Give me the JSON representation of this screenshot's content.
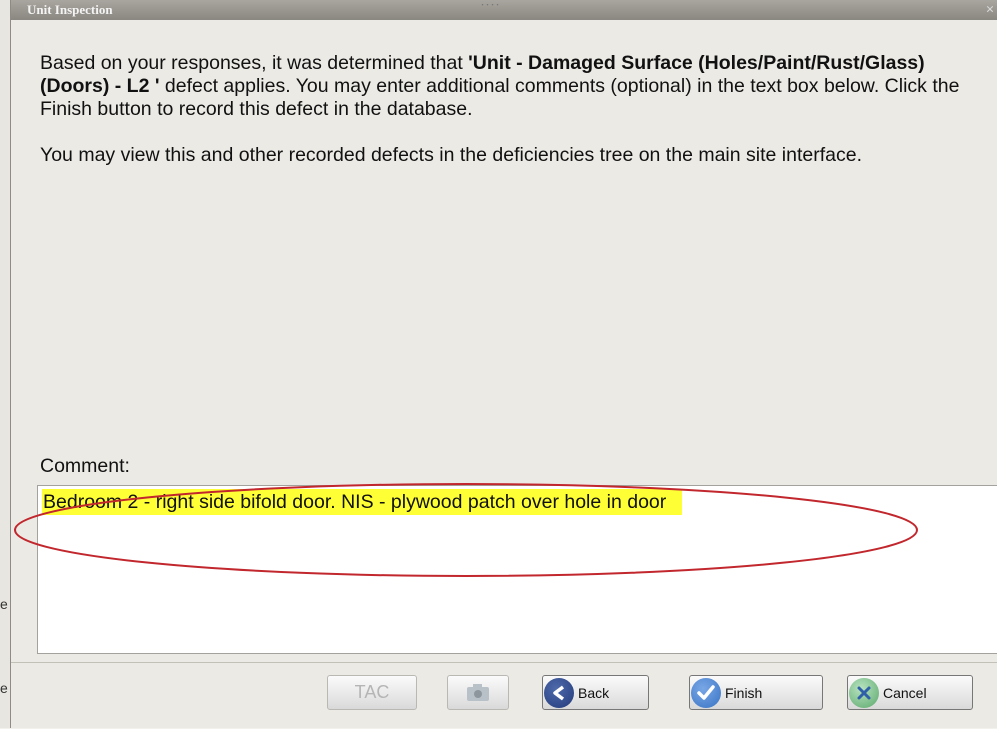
{
  "dialog": {
    "title": "Unit Inspection",
    "close": "×",
    "message": {
      "p1_before": "Based on your responses, it was determined that ",
      "p1_defect": "'Unit - Damaged Surface (Holes/Paint/Rust/Glass) (Doors) - L2 '",
      "p1_after": " defect applies. You may enter additional comments (optional) in the text box below. Click the Finish button to record this defect in the database.",
      "p2": "You may view this and other recorded defects in the deficiencies tree on the main site interface."
    },
    "comment_label": "Comment:",
    "comment_value": "Bedroom 2 - right side bifold door. NIS - plywood patch over hole in door"
  },
  "buttons": {
    "tac": "TAC",
    "camera_icon": "camera-icon",
    "back": "Back",
    "finish": "Finish",
    "cancel": "Cancel"
  },
  "background_fragments": [
    "e",
    "e"
  ],
  "colors": {
    "highlight": "#ffff35",
    "annotation_ellipse": "#c1272d",
    "back_icon": "#233a7a",
    "finish_icon": "#3873c4",
    "cancel_icon": "#5aa86b"
  }
}
